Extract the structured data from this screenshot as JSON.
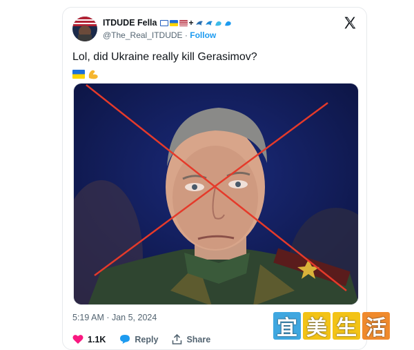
{
  "tweet": {
    "display_name": "ITDUDE Fella",
    "handle": "@The_Real_ITDUDE",
    "separator": "·",
    "follow_label": "Follow",
    "text": "Lol, did Ukraine really kill Gerasimov?",
    "timestamp": "5:19 AM · Jan 5, 2024",
    "likes": "1.1K",
    "reply_label": "Reply",
    "share_label": "Share"
  },
  "icons": {
    "platform": "x-logo-icon",
    "like": "heart-icon",
    "reply": "speech-bubble-icon",
    "share": "upload-arrow-icon"
  },
  "watermark": {
    "chars": [
      "宜",
      "美",
      "生",
      "活"
    ],
    "colors": [
      "#3fa7e0",
      "#f3c316",
      "#f3c316",
      "#f08a2c"
    ]
  },
  "colors": {
    "text": "#0f1419",
    "secondary": "#536471",
    "link": "#1d9bf0",
    "like": "#f91880",
    "cross": "#e53a2a"
  }
}
